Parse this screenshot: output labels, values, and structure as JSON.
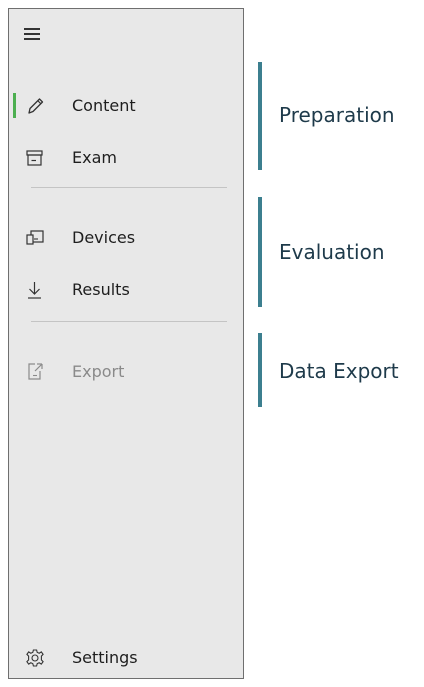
{
  "nav": {
    "items": [
      {
        "label": "Content",
        "icon": "pencil-icon",
        "selected": true
      },
      {
        "label": "Exam",
        "icon": "archive-box-icon"
      },
      {
        "label": "Devices",
        "icon": "devices-icon"
      },
      {
        "label": "Results",
        "icon": "download-arrow-icon"
      },
      {
        "label": "Export",
        "icon": "export-document-icon",
        "disabled": true
      }
    ],
    "settings": {
      "label": "Settings",
      "icon": "gear-icon"
    }
  },
  "groups": [
    {
      "label": "Preparation"
    },
    {
      "label": "Evaluation"
    },
    {
      "label": "Data Export"
    }
  ],
  "colors": {
    "selection_indicator": "#4caf50",
    "group_bar": "#3c7f8f",
    "sidebar_bg": "#e8e8e8"
  }
}
